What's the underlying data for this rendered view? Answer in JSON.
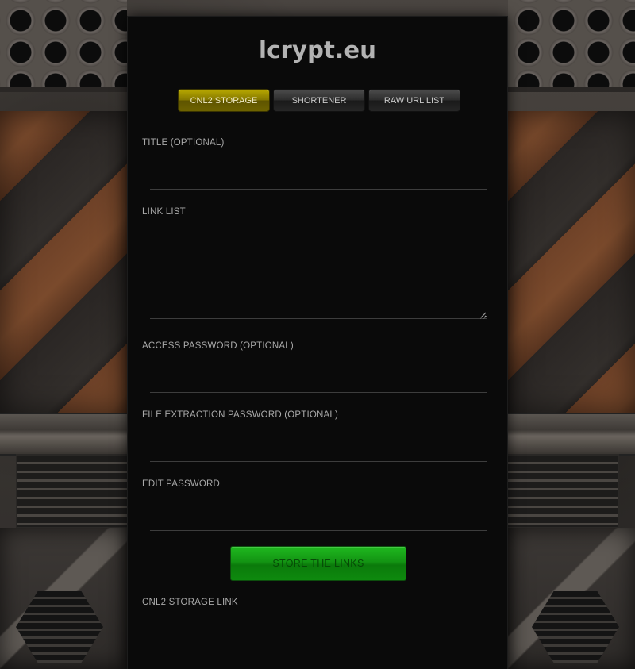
{
  "site": {
    "logo": "lcrypt.eu"
  },
  "tabs": [
    {
      "label": "CNL2 STORAGE",
      "active": true
    },
    {
      "label": "SHORTENER",
      "active": false
    },
    {
      "label": "RAW URL LIST",
      "active": false
    }
  ],
  "form": {
    "title_label": "TITLE (OPTIONAL)",
    "title_value": "",
    "link_list_label": "LINK LIST",
    "link_list_value": "",
    "access_password_label": "ACCESS PASSWORD (OPTIONAL)",
    "access_password_value": "",
    "extraction_password_label": "FILE EXTRACTION PASSWORD (OPTIONAL)",
    "extraction_password_value": "",
    "edit_password_label": "EDIT PASSWORD",
    "edit_password_value": "",
    "submit_label": "STORE THE LINKS",
    "result_label": "CNL2 STORAGE LINK"
  },
  "colors": {
    "active_tab": "#9a8c00",
    "submit_button": "#139413",
    "panel_background": "#0a0a0a"
  }
}
